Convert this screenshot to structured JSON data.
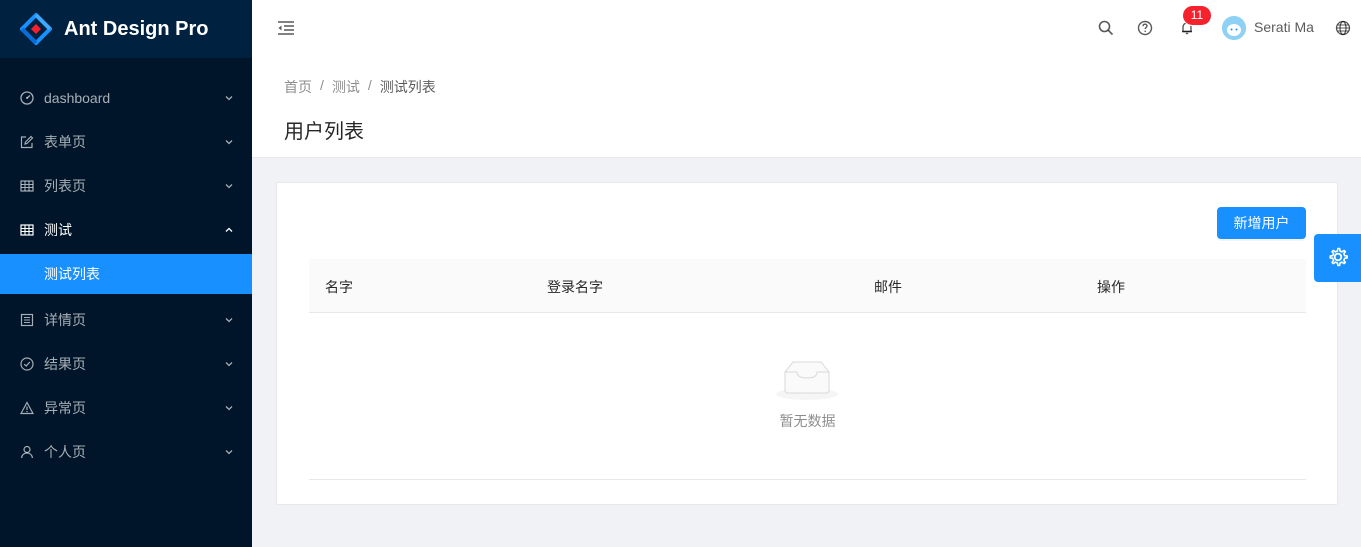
{
  "app": {
    "title": "Ant Design Pro"
  },
  "sidebar": {
    "items": [
      {
        "label": "dashboard",
        "icon": "dashboard-icon"
      },
      {
        "label": "表单页",
        "icon": "form-icon"
      },
      {
        "label": "列表页",
        "icon": "table-icon"
      },
      {
        "label": "测试",
        "icon": "table-icon",
        "open": true,
        "children": [
          {
            "label": "测试列表",
            "selected": true
          }
        ]
      },
      {
        "label": "详情页",
        "icon": "profile-icon"
      },
      {
        "label": "结果页",
        "icon": "check-circle-icon"
      },
      {
        "label": "异常页",
        "icon": "warning-icon"
      },
      {
        "label": "个人页",
        "icon": "user-icon"
      }
    ]
  },
  "header": {
    "notification_count": "11",
    "username": "Serati Ma"
  },
  "breadcrumb": [
    "首页",
    "测试",
    "测试列表"
  ],
  "page": {
    "title": "用户列表",
    "add_button": "新增用户"
  },
  "table": {
    "columns": [
      "名字",
      "登录名字",
      "邮件",
      "操作"
    ],
    "empty_text": "暂无数据"
  },
  "colors": {
    "primary": "#1890ff",
    "sider": "#001529",
    "badge": "#f5222d"
  }
}
